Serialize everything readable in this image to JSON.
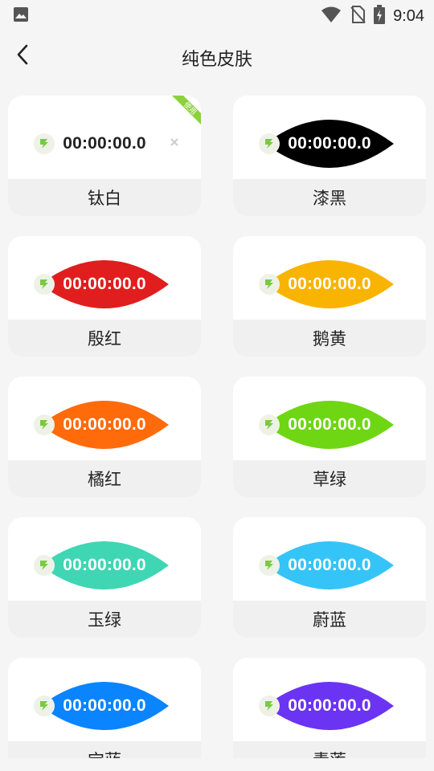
{
  "status_bar": {
    "time": "9:04",
    "icons": [
      "image-icon",
      "wifi-icon",
      "no-sim-icon",
      "battery-charging-icon"
    ]
  },
  "app_bar": {
    "back_icon": "chevron-left-icon",
    "title": "纯色皮肤"
  },
  "skins": [
    {
      "name": "钛白",
      "color": "#ffffff",
      "text_color": "#222222",
      "timer": "00:00:00.0",
      "in_use": true,
      "badge": "使用"
    },
    {
      "name": "漆黑",
      "color": "#000000",
      "text_color": "#ffffff",
      "timer": "00:00:00.0"
    },
    {
      "name": "殷红",
      "color": "#e01e1e",
      "text_color": "#ffffff",
      "timer": "00:00:00.0"
    },
    {
      "name": "鹅黄",
      "color": "#f8b400",
      "text_color": "#ffffff",
      "timer": "00:00:00.0"
    },
    {
      "name": "橘红",
      "color": "#ff6b0a",
      "text_color": "#ffffff",
      "timer": "00:00:00.0"
    },
    {
      "name": "草绿",
      "color": "#6ed612",
      "text_color": "#ffffff",
      "timer": "00:00:00.0"
    },
    {
      "name": "玉绿",
      "color": "#3fd6b3",
      "text_color": "#ffffff",
      "timer": "00:00:00.0"
    },
    {
      "name": "蔚蓝",
      "color": "#35c4f8",
      "text_color": "#ffffff",
      "timer": "00:00:00.0"
    },
    {
      "name": "宝蓝",
      "color": "#0a84ff",
      "text_color": "#ffffff",
      "timer": "00:00:00.0"
    },
    {
      "name": "青莲",
      "color": "#6a34f2",
      "text_color": "#ffffff",
      "timer": "00:00:00.0"
    }
  ]
}
